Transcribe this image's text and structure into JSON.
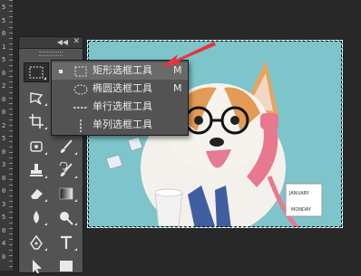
{
  "ruler": {
    "ticks": [
      "5",
      "5",
      "0",
      "1",
      "5",
      "0",
      "2",
      "0",
      "0",
      "2",
      "5",
      "0",
      "3",
      "0",
      "0",
      "3",
      "5",
      "0",
      "4",
      "0"
    ]
  },
  "toolbar": {
    "collapse_icon": "double-chevron-left-icon",
    "close_icon": "close-icon",
    "tools": [
      "rectangular-marquee-tool-icon",
      "lasso-tool-icon",
      "crop-tool-icon",
      "eyedropper-tool-icon",
      "spot-healing-brush-icon",
      "brush-tool-icon",
      "clone-stamp-icon",
      "history-brush-icon",
      "eraser-tool-icon",
      "gradient-tool-icon",
      "blur-tool-icon",
      "dodge-tool-icon",
      "pen-tool-icon",
      "type-tool-icon",
      "path-selection-icon",
      "rectangle-shape-icon"
    ]
  },
  "menu": {
    "items": [
      {
        "label": "矩形选框工具",
        "key": "M",
        "icon": "rectangular-marquee-icon",
        "selected": true
      },
      {
        "label": "椭圆选框工具",
        "key": "M",
        "icon": "elliptical-marquee-icon",
        "selected": false
      },
      {
        "label": "单行选框工具",
        "key": "",
        "icon": "single-row-marquee-icon",
        "selected": false
      },
      {
        "label": "单列选框工具",
        "key": "",
        "icon": "single-column-marquee-icon",
        "selected": false
      }
    ]
  },
  "image": {
    "subject": "corgi-with-glasses-phone-illustration",
    "background_color": "#7dc5cb",
    "calendar_text": [
      "JANUARY",
      "MONDAY"
    ]
  },
  "colors": {
    "arrow": "#e8343b",
    "panel": "#535353",
    "workspace": "#282828"
  }
}
